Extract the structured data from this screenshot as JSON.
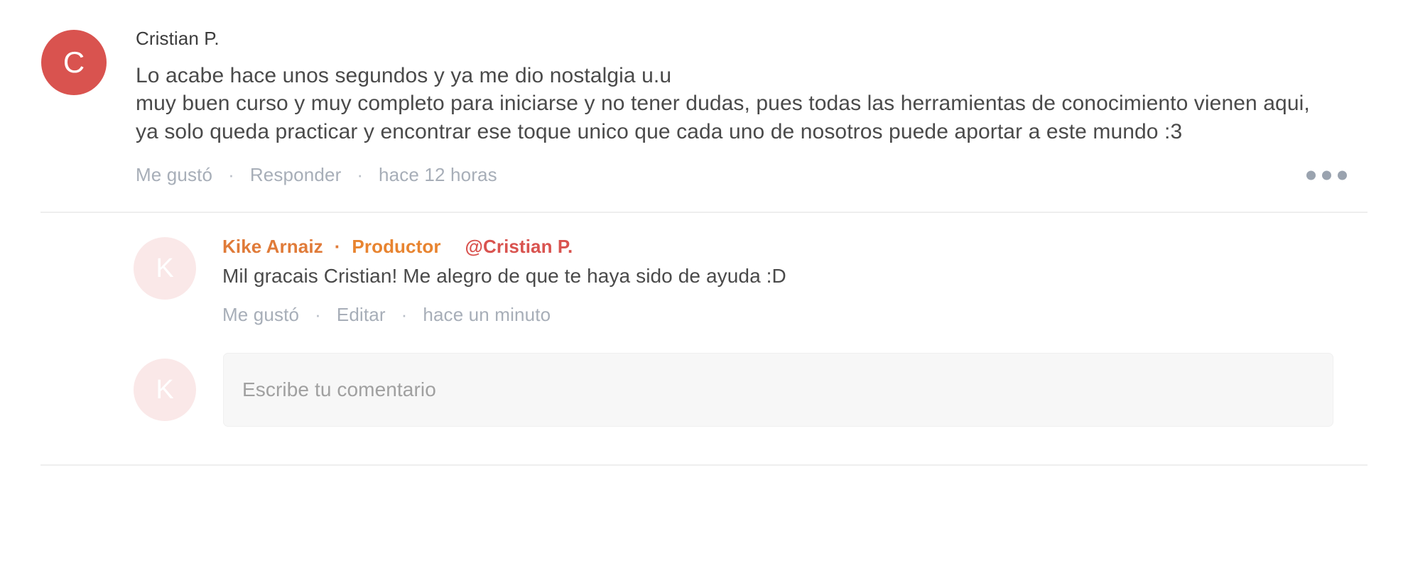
{
  "comment": {
    "avatar": {
      "initial": "C",
      "color": "#d9534f"
    },
    "author": "Cristian P.",
    "text": "Lo acabe hace unos segundos y ya me dio nostalgia u.u\nmuy buen curso y muy completo para iniciarse y no tener dudas, pues todas las herramientas de conocimiento vienen aqui, ya solo queda practicar y encontrar ese toque unico que cada uno de nosotros puede aportar a este mundo :3",
    "actions": {
      "like_label": "Me gustó",
      "reply_label": "Responder",
      "separator": "·",
      "timestamp": "hace 12 horas"
    },
    "more_menu_label": "•••"
  },
  "reply": {
    "avatar": {
      "initial": "K",
      "color": "#fae8e8"
    },
    "author": "Kike Arnaiz",
    "separator": "·",
    "badge": "Productor",
    "mention": "@Cristian P.",
    "text": "Mil gracais Cristian! Me alegro de que te haya sido de ayuda :D",
    "actions": {
      "like_label": "Me gustó",
      "edit_label": "Editar",
      "separator": "·",
      "timestamp": "hace un minuto"
    }
  },
  "compose": {
    "avatar": {
      "initial": "K",
      "color": "#fae8e8"
    },
    "placeholder": "Escribe tu comentario",
    "value": ""
  },
  "colors": {
    "accent_orange": "#e07b39",
    "badge_orange": "#e88430",
    "mention_red": "#d9534f",
    "muted_gray": "#a7aeb8",
    "text_gray": "#4a4a4a",
    "divider": "#eeeeee",
    "field_bg": "#f7f7f7"
  }
}
